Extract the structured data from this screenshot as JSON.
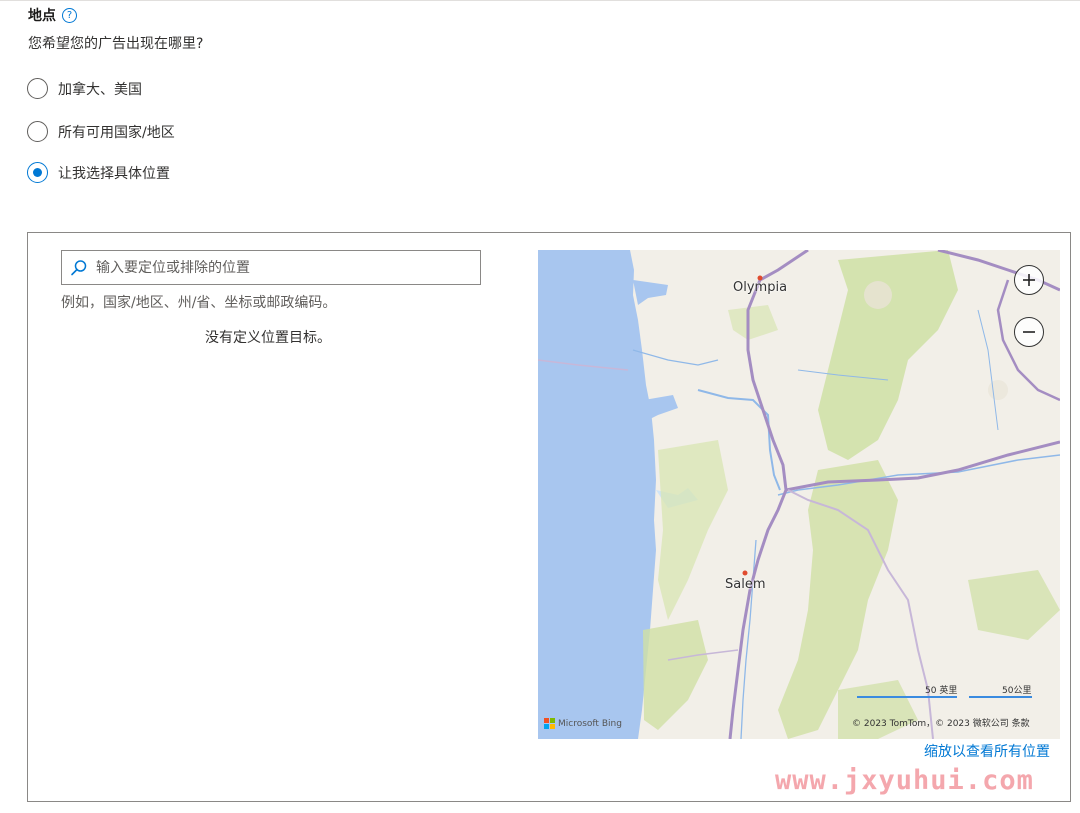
{
  "section": {
    "title": "地点",
    "help_icon": "?",
    "subtitle": "您希望您的广告出现在哪里?"
  },
  "radios": [
    {
      "label": "加拿大、美国",
      "checked": false
    },
    {
      "label": "所有可用国家/地区",
      "checked": false
    },
    {
      "label": "让我选择具体位置",
      "checked": true
    }
  ],
  "search": {
    "placeholder": "输入要定位或排除的位置",
    "value": "",
    "hint": "例如，国家/地区、州/省、坐标或邮政编码。"
  },
  "empty_message": "没有定义位置目标。",
  "map": {
    "cities": [
      "Olympia",
      "Salem"
    ],
    "zoom_in_icon": "plus-icon",
    "zoom_out_icon": "minus-icon",
    "scale_miles": "50 英里",
    "scale_km": "50公里",
    "bing_brand": "Microsoft Bing",
    "copyright": "© 2023 TomTom，© 2023 微软公司  条款",
    "colors": {
      "water": "#a8c6ef",
      "land": "#f2efe8",
      "forest": "#cfe0a4",
      "highway": "#a48dc2",
      "river": "#8fb8e8"
    }
  },
  "zoom_link": "缩放以查看所有位置",
  "watermark": "www.jxyuhui.com",
  "colors": {
    "accent": "#0078d4",
    "border": "#8a8886"
  }
}
